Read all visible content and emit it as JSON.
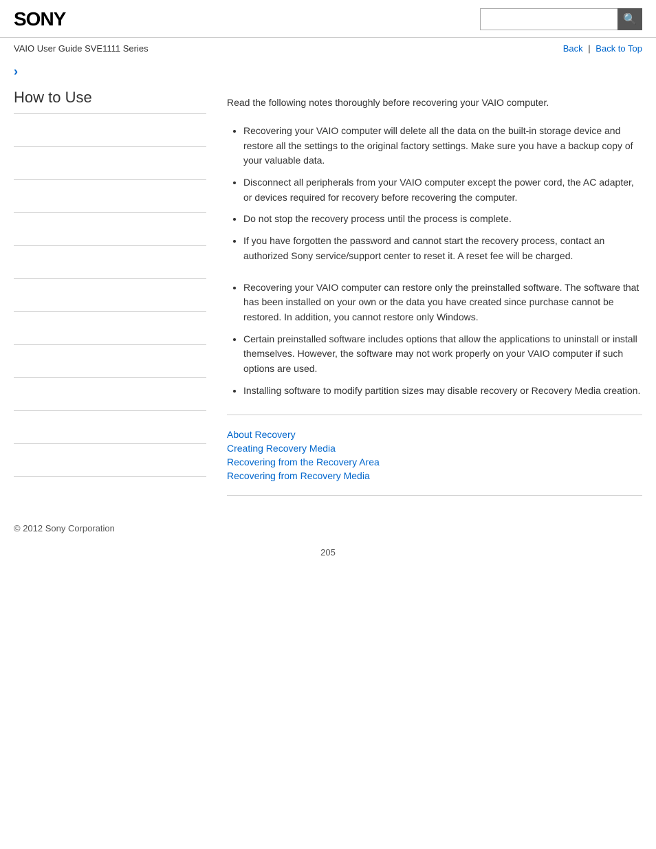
{
  "header": {
    "logo": "SONY",
    "search_placeholder": "",
    "search_icon": "🔍"
  },
  "subheader": {
    "guide_title": "VAIO User Guide SVE1111 Series",
    "back_label": "Back",
    "separator": "|",
    "back_to_top_label": "Back to Top"
  },
  "breadcrumb": {
    "arrow": "›"
  },
  "sidebar": {
    "title": "How to Use",
    "items": [
      {
        "label": ""
      },
      {
        "label": ""
      },
      {
        "label": ""
      },
      {
        "label": ""
      },
      {
        "label": ""
      },
      {
        "label": ""
      },
      {
        "label": ""
      },
      {
        "label": ""
      },
      {
        "label": ""
      },
      {
        "label": ""
      },
      {
        "label": ""
      },
      {
        "label": ""
      }
    ]
  },
  "content": {
    "intro": "Read the following notes thoroughly before recovering your VAIO computer.",
    "section1_bullets": [
      "Recovering your VAIO computer will delete all the data on the built-in storage device and restore all the settings to the original factory settings. Make sure you have a backup copy of your valuable data.",
      "Disconnect all peripherals from your VAIO computer except the power cord, the AC adapter, or devices required for recovery before recovering the computer.",
      "Do not stop the recovery process until the process is complete.",
      "If you have forgotten the password and cannot start the recovery process, contact an authorized Sony service/support center to reset it. A reset fee will be charged."
    ],
    "section2_bullets": [
      "Recovering your VAIO computer can restore only the preinstalled software. The software that has been installed on your own or the data you have created since purchase cannot be restored. In addition, you cannot restore only Windows.",
      "Certain preinstalled software includes options that allow the applications to uninstall or install themselves. However, the software may not work properly on your VAIO computer if such options are used.",
      "Installing software to modify partition sizes may disable recovery or Recovery Media creation."
    ],
    "links": [
      {
        "label": "About Recovery",
        "href": "#"
      },
      {
        "label": "Creating Recovery Media",
        "href": "#"
      },
      {
        "label": "Recovering from the Recovery Area",
        "href": "#"
      },
      {
        "label": "Recovering from Recovery Media",
        "href": "#"
      }
    ]
  },
  "footer": {
    "copyright": "© 2012 Sony Corporation"
  },
  "page_number": "205"
}
